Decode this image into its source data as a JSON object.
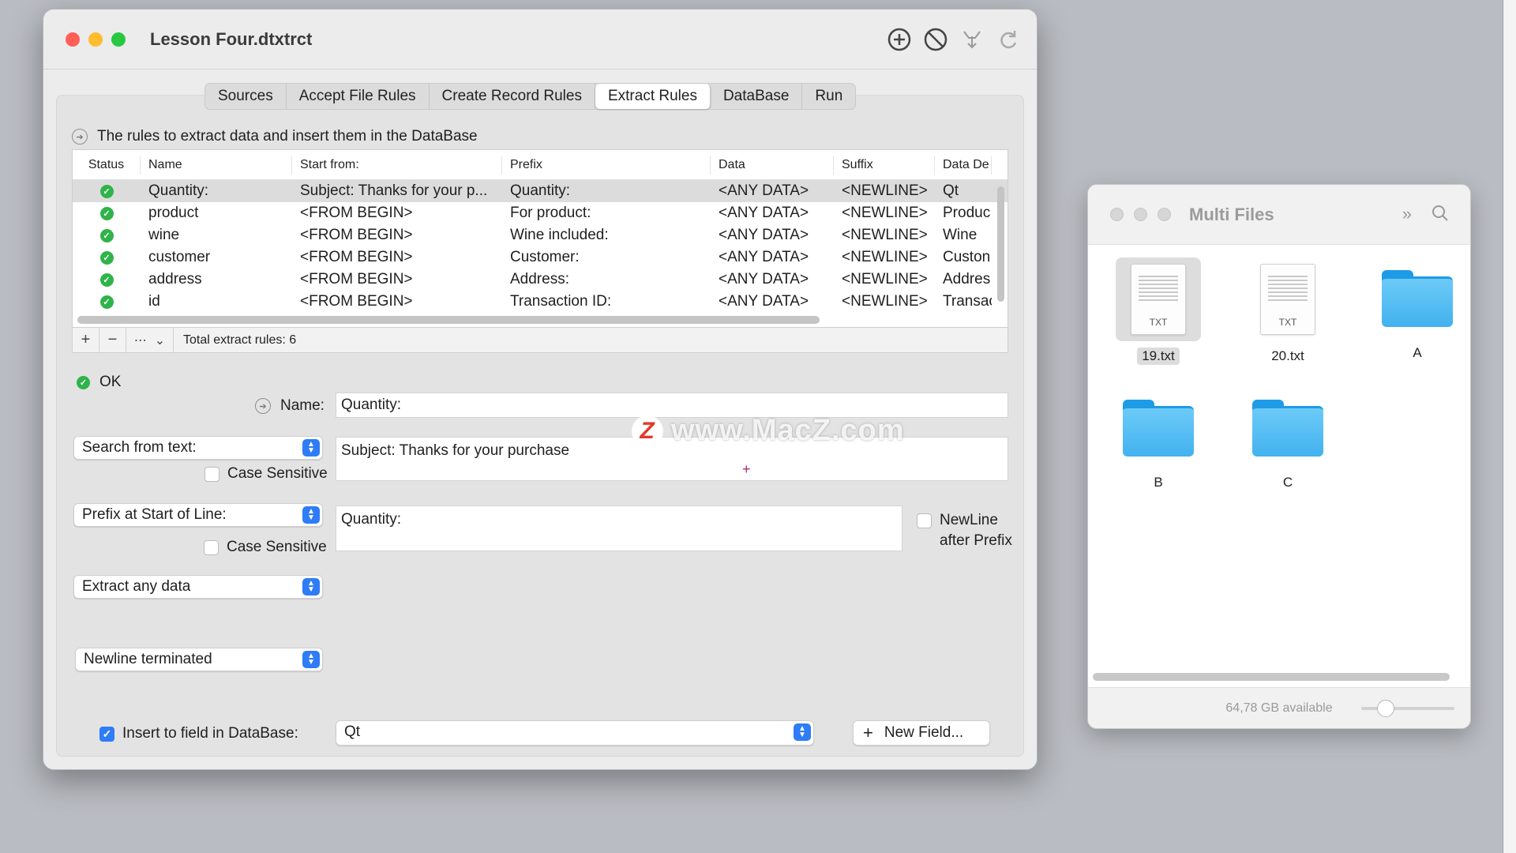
{
  "window": {
    "title": "Lesson Four.dtxtrct",
    "tabs": [
      "Sources",
      "Accept File Rules",
      "Create Record Rules",
      "Extract Rules",
      "DataBase",
      "Run"
    ],
    "active_tab": "Extract Rules",
    "description": "The rules to extract data and insert them in the DataBase"
  },
  "table": {
    "columns": [
      "Status",
      "Name",
      "Start from:",
      "Prefix",
      "Data",
      "Suffix",
      "Data De"
    ],
    "rows": [
      [
        "Quantity:",
        "Subject: Thanks for your p...",
        "Quantity:",
        "<ANY DATA>",
        "<NEWLINE>",
        "Qt"
      ],
      [
        "product",
        "<FROM BEGIN>",
        "For product:",
        "<ANY DATA>",
        "<NEWLINE>",
        "Produc"
      ],
      [
        "wine",
        "<FROM BEGIN>",
        "Wine included:",
        "<ANY DATA>",
        "<NEWLINE>",
        "Wine"
      ],
      [
        "customer",
        "<FROM BEGIN>",
        "Customer:",
        "<ANY DATA>",
        "<NEWLINE>",
        "Custon"
      ],
      [
        "address",
        "<FROM BEGIN>",
        "Address:",
        "<ANY DATA>",
        "<NEWLINE>",
        "Addres"
      ],
      [
        "id",
        "<FROM BEGIN>",
        "Transaction ID:",
        "<ANY DATA>",
        "<NEWLINE>",
        "Transac"
      ]
    ],
    "footer": "Total extract rules: 6"
  },
  "form": {
    "status": "OK",
    "name_label": "Name:",
    "name_value": "Quantity:",
    "search_popup": "Search from text:",
    "search_value": "Subject: Thanks for your purchase",
    "case_sensitive_label": "Case Sensitive",
    "prefix_popup": "Prefix at Start of Line:",
    "prefix_value": "Quantity:",
    "newline_label_1": "NewLine",
    "newline_label_2": "after Prefix",
    "extract_popup": "Extract any data",
    "terminator_popup": "Newline terminated",
    "insert_label": "Insert to field in DataBase:",
    "field_value": "Qt",
    "new_field_button": "New Field..."
  },
  "watermark": {
    "z": "Z",
    "text": "www.MacZ.com"
  },
  "finder": {
    "title": "Multi Files",
    "items": [
      {
        "name": "19.txt",
        "kind": "TXT",
        "selected": true
      },
      {
        "name": "20.txt",
        "kind": "TXT",
        "selected": false
      },
      {
        "name": "A",
        "kind": "folder"
      },
      {
        "name": "B",
        "kind": "folder"
      },
      {
        "name": "C",
        "kind": "folder"
      }
    ],
    "status": "64,78 GB available"
  }
}
